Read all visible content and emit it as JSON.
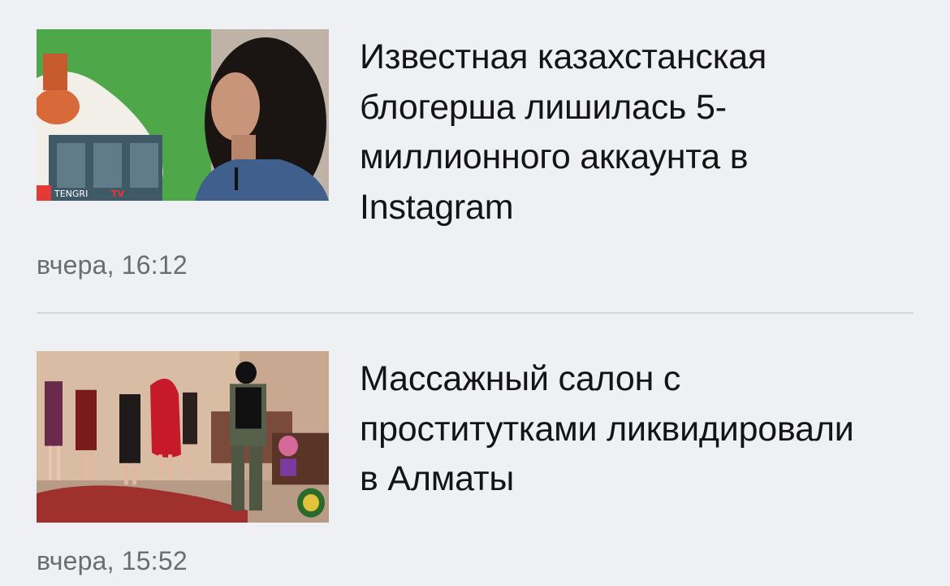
{
  "news": [
    {
      "headline": "Известная казахстанская блогерша лишилась 5-миллионного аккаунта в Instagram",
      "time": "вчера, 16:12",
      "image_watermark": "TENGRI TV",
      "accent_color": "#e53935"
    },
    {
      "headline": "Массажный салон с проститутками ликвидировали в Алматы",
      "time": "вчера, 15:52"
    }
  ]
}
